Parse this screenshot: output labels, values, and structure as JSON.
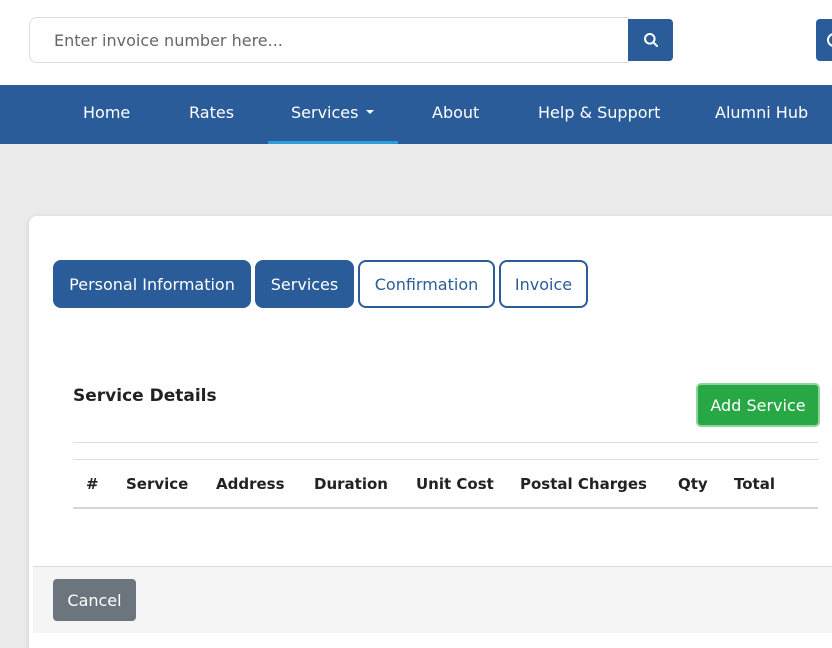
{
  "search": {
    "placeholder": "Enter invoice number here...",
    "button_icon": "search-icon"
  },
  "nav": {
    "items": [
      {
        "label": "Home",
        "active": false
      },
      {
        "label": "Rates",
        "active": false
      },
      {
        "label": "Services",
        "active": true,
        "dropdown": true
      },
      {
        "label": "About",
        "active": false
      },
      {
        "label": "Help & Support",
        "active": false
      },
      {
        "label": "Alumni Hub",
        "active": false
      }
    ]
  },
  "steps": [
    {
      "label": "Personal Information",
      "state": "completed"
    },
    {
      "label": "Services",
      "state": "current"
    },
    {
      "label": "Confirmation",
      "state": "pending"
    },
    {
      "label": "Invoice",
      "state": "pending"
    }
  ],
  "service_details": {
    "title": "Service Details",
    "add_button": "Add Service",
    "columns": [
      "#",
      "Service",
      "Address",
      "Duration",
      "Unit Cost",
      "Postal Charges",
      "Qty",
      "Total"
    ],
    "rows": []
  },
  "footer": {
    "cancel_label": "Cancel"
  },
  "colors": {
    "primary": "#2a5c9a",
    "success": "#28a745",
    "secondary": "#6c757d",
    "active_underline": "#2d9cdb",
    "page_bg": "#ebebeb"
  }
}
